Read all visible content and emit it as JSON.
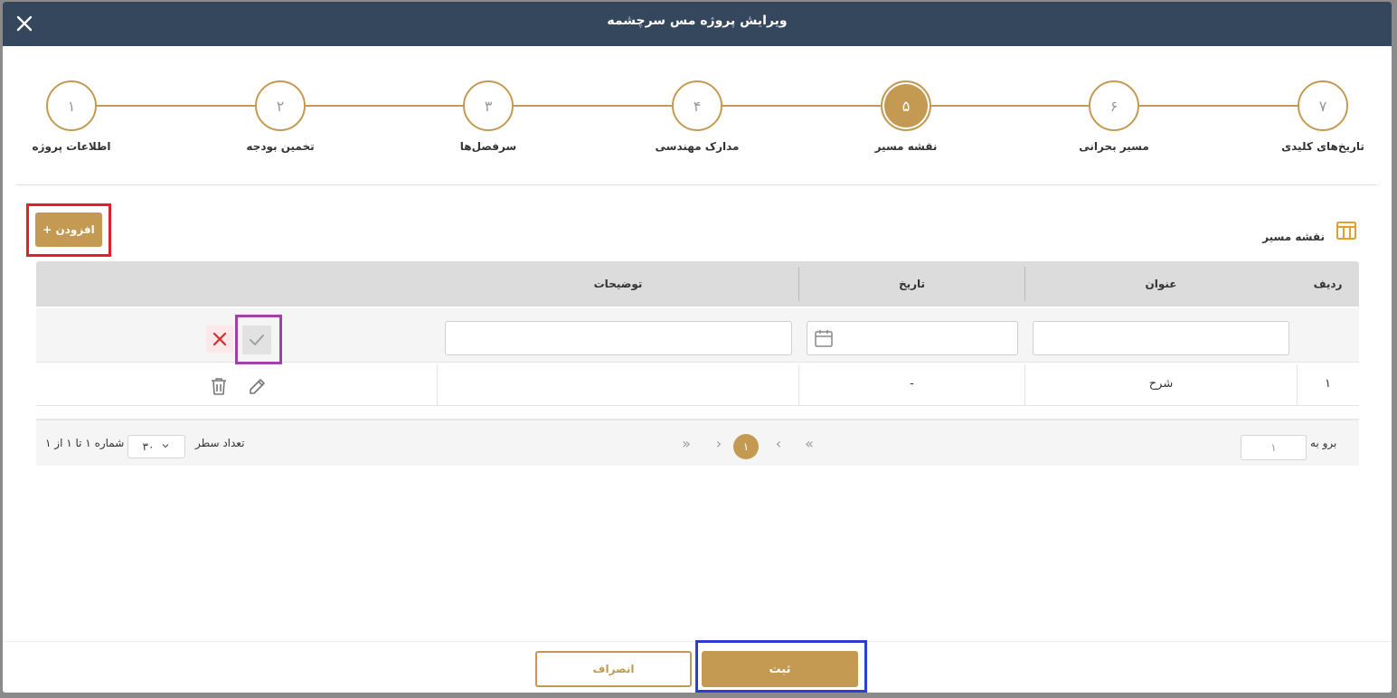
{
  "dialog": {
    "title": "ویرایش پروژه مس سرچشمه"
  },
  "steps": [
    {
      "number": "۷",
      "label": "تاریخ‌های کلیدی"
    },
    {
      "number": "۶",
      "label": "مسیر بحرانی"
    },
    {
      "number": "۵",
      "label": "نقشه مسیر"
    },
    {
      "number": "۴",
      "label": "مدارک مهندسی"
    },
    {
      "number": "۳",
      "label": "سرفصل‌ها"
    },
    {
      "number": "۲",
      "label": "تخمین بودجه"
    },
    {
      "number": "۱",
      "label": "اطلاعات پروژه"
    }
  ],
  "active_step": "۵",
  "section": {
    "title": "نقشه مسیر",
    "add_label": "+ افزودن"
  },
  "table": {
    "columns": {
      "row": "ردیف",
      "title": "عنوان",
      "date": "تاریخ",
      "description": "توضیحات"
    },
    "rows": [
      {
        "row": "۱",
        "title": "شرح",
        "date": "-",
        "description": ""
      }
    ]
  },
  "pager": {
    "goto_label": "برو به",
    "goto_value": "۱",
    "current_page": "۱",
    "rows_label": "تعداد سطر",
    "rows_value": "۳۰",
    "range_text": "شماره ۱ تا ۱ از ۱"
  },
  "footer": {
    "save_label": "ثبت",
    "cancel_label": "انصراف"
  },
  "colors": {
    "header": "#34475c",
    "accent": "#c49a52",
    "danger": "#d32f2f"
  }
}
